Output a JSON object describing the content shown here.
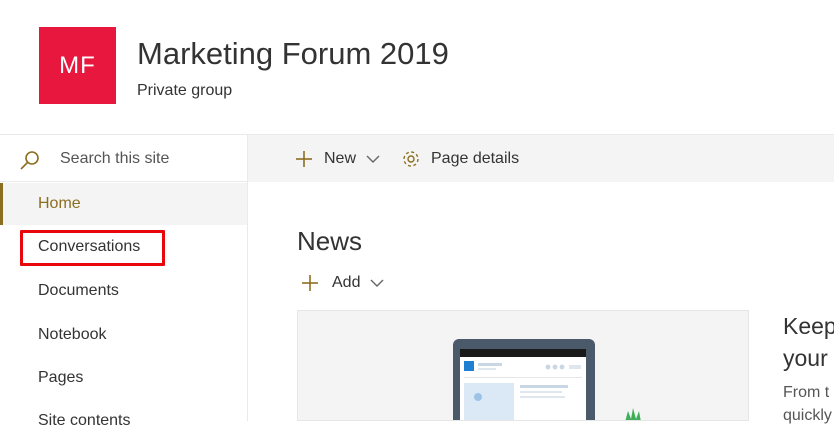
{
  "header": {
    "logo_initials": "MF",
    "logo_color": "#e8173e",
    "title": "Marketing Forum 2019",
    "subtitle": "Private group"
  },
  "sidebar": {
    "search_placeholder": "Search this site",
    "search_icon": "search-icon",
    "items": [
      {
        "label": "Home",
        "active": true
      },
      {
        "label": "Conversations",
        "active": false,
        "highlighted": true
      },
      {
        "label": "Documents",
        "active": false
      },
      {
        "label": "Notebook",
        "active": false
      },
      {
        "label": "Pages",
        "active": false
      },
      {
        "label": "Site contents",
        "active": false
      }
    ]
  },
  "command_bar": {
    "new_label": "New",
    "page_details_label": "Page details"
  },
  "news": {
    "title": "News",
    "add_label": "Add",
    "promo_title": "Keep\nyour",
    "promo_body": "From t\nquickly"
  },
  "colors": {
    "accent": "#8b6e1f",
    "highlight_box": "#e8070b",
    "command_bar_bg": "#f4f4f4"
  }
}
